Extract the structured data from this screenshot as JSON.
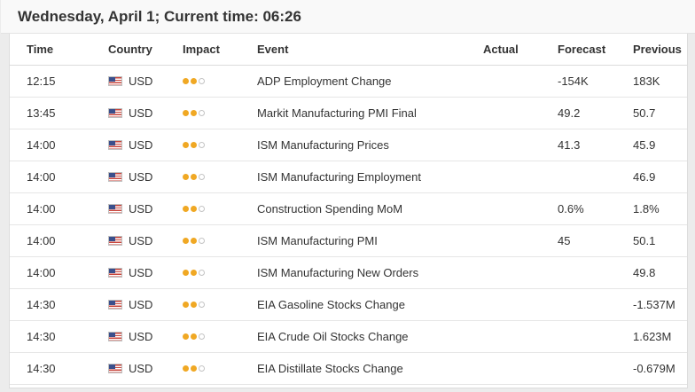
{
  "title": "Wednesday, April 1; Current time: 06:26",
  "columns": {
    "time": "Time",
    "country": "Country",
    "impact": "Impact",
    "event": "Event",
    "actual": "Actual",
    "forecast": "Forecast",
    "previous": "Previous"
  },
  "colors": {
    "impact_on": "#f0a824",
    "impact_off": "#ffffff"
  },
  "rows": [
    {
      "time": "12:15",
      "country": "USD",
      "impact_level": 2,
      "event": "ADP Employment Change",
      "actual": "",
      "forecast": "-154K",
      "previous": "183K"
    },
    {
      "time": "13:45",
      "country": "USD",
      "impact_level": 2,
      "event": "Markit Manufacturing PMI Final",
      "actual": "",
      "forecast": "49.2",
      "previous": "50.7"
    },
    {
      "time": "14:00",
      "country": "USD",
      "impact_level": 2,
      "event": "ISM Manufacturing Prices",
      "actual": "",
      "forecast": "41.3",
      "previous": "45.9"
    },
    {
      "time": "14:00",
      "country": "USD",
      "impact_level": 2,
      "event": "ISM Manufacturing Employment",
      "actual": "",
      "forecast": "",
      "previous": "46.9"
    },
    {
      "time": "14:00",
      "country": "USD",
      "impact_level": 2,
      "event": "Construction Spending MoM",
      "actual": "",
      "forecast": "0.6%",
      "previous": "1.8%"
    },
    {
      "time": "14:00",
      "country": "USD",
      "impact_level": 2,
      "event": "ISM Manufacturing PMI",
      "actual": "",
      "forecast": "45",
      "previous": "50.1"
    },
    {
      "time": "14:00",
      "country": "USD",
      "impact_level": 2,
      "event": "ISM Manufacturing New Orders",
      "actual": "",
      "forecast": "",
      "previous": "49.8"
    },
    {
      "time": "14:30",
      "country": "USD",
      "impact_level": 2,
      "event": "EIA Gasoline Stocks Change",
      "actual": "",
      "forecast": "",
      "previous": "-1.537M"
    },
    {
      "time": "14:30",
      "country": "USD",
      "impact_level": 2,
      "event": "EIA Crude Oil Stocks Change",
      "actual": "",
      "forecast": "",
      "previous": "1.623M"
    },
    {
      "time": "14:30",
      "country": "USD",
      "impact_level": 2,
      "event": "EIA Distillate Stocks Change",
      "actual": "",
      "forecast": "",
      "previous": "-0.679M"
    }
  ]
}
